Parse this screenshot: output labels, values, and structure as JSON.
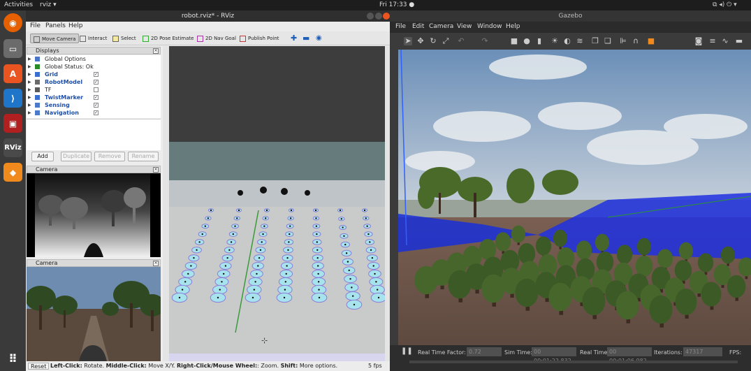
{
  "topbar": {
    "activities": "Activities",
    "app": "rviz ▾",
    "clock": "Fri 17:33 ●"
  },
  "dock": {
    "items": [
      "firefox-icon",
      "files-icon",
      "software-icon",
      "vscode-icon",
      "terminal-icon",
      "rviz-icon",
      "gazebo-icon",
      "apps-grid-icon"
    ],
    "rviz_label": "RViz"
  },
  "rviz": {
    "title": "robot.rviz* - RViz",
    "menu": [
      "File",
      "Panels",
      "Help"
    ],
    "tools": [
      "Move Camera",
      "Interact",
      "Select",
      "2D Pose Estimate",
      "2D Nav Goal",
      "Publish Point"
    ],
    "displays_title": "Displays",
    "displays": [
      {
        "label": "Global Options",
        "blue": false,
        "checked": null
      },
      {
        "label": "Global Status: Ok",
        "blue": false,
        "checked": null
      },
      {
        "label": "Grid",
        "blue": true,
        "checked": true
      },
      {
        "label": "RobotModel",
        "blue": true,
        "checked": true
      },
      {
        "label": "TF",
        "blue": false,
        "checked": false
      },
      {
        "label": "TwistMarker",
        "blue": true,
        "checked": true
      },
      {
        "label": "Sensing",
        "blue": true,
        "checked": true
      },
      {
        "label": "Navigation",
        "blue": true,
        "checked": true
      }
    ],
    "buttons": [
      "Add",
      "Duplicate",
      "Remove",
      "Rename"
    ],
    "camera1_title": "Camera",
    "camera2_title": "Camera",
    "status": {
      "reset": "Reset",
      "hint_b1": "Left-Click:",
      "hint_t1": " Rotate. ",
      "hint_b2": "Middle-Click:",
      "hint_t2": " Move X/Y. ",
      "hint_b3": "Right-Click/Mouse Wheel:",
      "hint_t3": ": Zoom. ",
      "hint_b4": "Shift:",
      "hint_t4": " More options.",
      "fps": "5 fps"
    }
  },
  "gazebo": {
    "title": "Gazebo",
    "menu": [
      "File",
      "Edit",
      "Camera",
      "View",
      "Window",
      "Help"
    ],
    "real_time_factor_label": "Real Time Factor:",
    "real_time_factor": "0.72",
    "sim_time_label": "Sim Time:",
    "sim_time": "00 00:01:22.832",
    "real_time_label": "Real Time:",
    "real_time": "00 00:01:06.982",
    "iterations_label": "Iterations:",
    "iterations": "47317",
    "fps_label": "FPS:"
  }
}
